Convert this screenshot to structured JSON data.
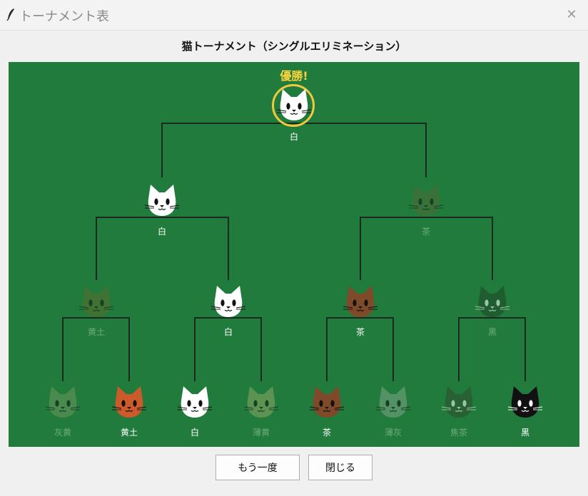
{
  "window": {
    "title": "トーナメント表",
    "icon": "feather-icon",
    "close_icon": "close-icon",
    "close_glyph": "✕"
  },
  "heading": "猫トーナメント（シングルエリミネーション）",
  "board": {
    "background": "#217b3c",
    "champion_label": "優勝!",
    "champion_label_color": "#f7d23c",
    "ring_color": "#f0c93c",
    "line_color": "#1b2a1e"
  },
  "rounds": {
    "final_winner": {
      "name": "白",
      "face": "#ffffff",
      "eliminated": false
    },
    "round1": [
      {
        "name": "白",
        "face": "#ffffff",
        "eliminated": false
      },
      {
        "name": "茶",
        "face": "#4e6a36",
        "eliminated": true
      }
    ],
    "round2": [
      {
        "name": "黄土",
        "face": "#5b6b2c",
        "eliminated": true
      },
      {
        "name": "白",
        "face": "#ffffff",
        "eliminated": false
      },
      {
        "name": "茶",
        "face": "#7e4a2a",
        "eliminated": false
      },
      {
        "name": "黒",
        "face": "#1f4326",
        "eliminated": true
      }
    ],
    "round3": [
      {
        "name": "灰黄",
        "face": "#6e9860",
        "eliminated": true
      },
      {
        "name": "黄土",
        "face": "#cc5a2a",
        "eliminated": false
      },
      {
        "name": "白",
        "face": "#ffffff",
        "eliminated": false
      },
      {
        "name": "薄黄",
        "face": "#8fa865",
        "eliminated": true
      },
      {
        "name": "茶",
        "face": "#7e4a2a",
        "eliminated": false
      },
      {
        "name": "薄灰",
        "face": "#7ca685",
        "eliminated": true
      },
      {
        "name": "焦茶",
        "face": "#2c4c2e",
        "eliminated": true
      },
      {
        "name": "黒",
        "face": "#111111",
        "eliminated": false
      }
    ]
  },
  "buttons": {
    "again": "もう一度",
    "close": "閉じる"
  }
}
